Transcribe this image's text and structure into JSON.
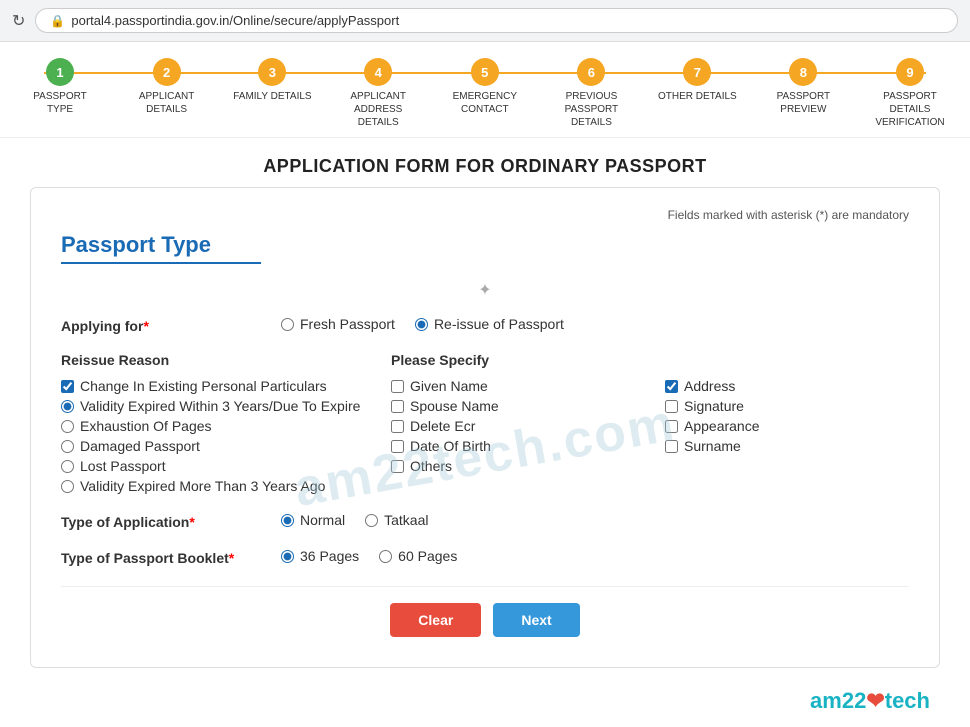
{
  "browser": {
    "url": "portal4.passportindia.gov.in/Online/secure/applyPassport"
  },
  "steps": [
    {
      "number": "1",
      "label": "PASSPORT TYPE",
      "active": true
    },
    {
      "number": "2",
      "label": "APPLICANT DETAILS",
      "active": false
    },
    {
      "number": "3",
      "label": "FAMILY DETAILS",
      "active": false
    },
    {
      "number": "4",
      "label": "APPLICANT ADDRESS DETAILS",
      "active": false
    },
    {
      "number": "5",
      "label": "EMERGENCY CONTACT",
      "active": false
    },
    {
      "number": "6",
      "label": "PREVIOUS PASSPORT DETAILS",
      "active": false
    },
    {
      "number": "7",
      "label": "OTHER DETAILS",
      "active": false
    },
    {
      "number": "8",
      "label": "PASSPORT PREVIEW",
      "active": false
    },
    {
      "number": "9",
      "label": "PASSPORT DETAILS VERIFICATION",
      "active": false
    }
  ],
  "page_title": "APPLICATION FORM FOR ORDINARY PASSPORT",
  "mandatory_note": "Fields marked with asterisk (*) are mandatory",
  "section_title": "Passport Type",
  "applying_for_label": "Applying for",
  "applying_for_options": [
    {
      "value": "fresh",
      "label": "Fresh Passport"
    },
    {
      "value": "reissue",
      "label": "Re-issue of Passport",
      "checked": true
    }
  ],
  "reissue_reason_label": "Reissue Reason",
  "reissue_reasons": [
    {
      "value": "change",
      "label": "Change In Existing Personal Particulars",
      "type": "checkbox",
      "checked": true
    },
    {
      "value": "validity3",
      "label": "Validity Expired Within 3 Years/Due To Expire",
      "type": "radio",
      "checked": true
    },
    {
      "value": "exhaustion",
      "label": "Exhaustion Of Pages",
      "type": "radio",
      "checked": false
    },
    {
      "value": "damaged",
      "label": "Damaged Passport",
      "type": "radio",
      "checked": false
    },
    {
      "value": "lost",
      "label": "Lost Passport",
      "type": "radio",
      "checked": false
    },
    {
      "value": "validity3plus",
      "label": "Validity Expired More Than 3 Years Ago",
      "type": "radio",
      "checked": false
    }
  ],
  "please_specify_label": "Please Specify",
  "specify_options": [
    {
      "label": "Given Name",
      "checked": false
    },
    {
      "label": "Address",
      "checked": true
    },
    {
      "label": "Spouse Name",
      "checked": false
    },
    {
      "label": "Signature",
      "checked": false
    },
    {
      "label": "Delete Ecr",
      "checked": false
    },
    {
      "label": "Appearance",
      "checked": false
    },
    {
      "label": "Date Of Birth",
      "checked": false
    },
    {
      "label": "Surname",
      "checked": false
    },
    {
      "label": "Others",
      "checked": false
    }
  ],
  "type_of_application_label": "Type of Application",
  "application_types": [
    {
      "value": "normal",
      "label": "Normal",
      "checked": true
    },
    {
      "value": "tatkaal",
      "label": "Tatkaal",
      "checked": false
    }
  ],
  "type_of_booklet_label": "Type of Passport Booklet",
  "booklet_types": [
    {
      "value": "36",
      "label": "36 Pages",
      "checked": true
    },
    {
      "value": "60",
      "label": "60 Pages",
      "checked": false
    }
  ],
  "btn_clear": "Clear",
  "btn_next": "Next",
  "brand": "am22",
  "brand_suffix": "tech",
  "watermark_text": "am22tech.com"
}
